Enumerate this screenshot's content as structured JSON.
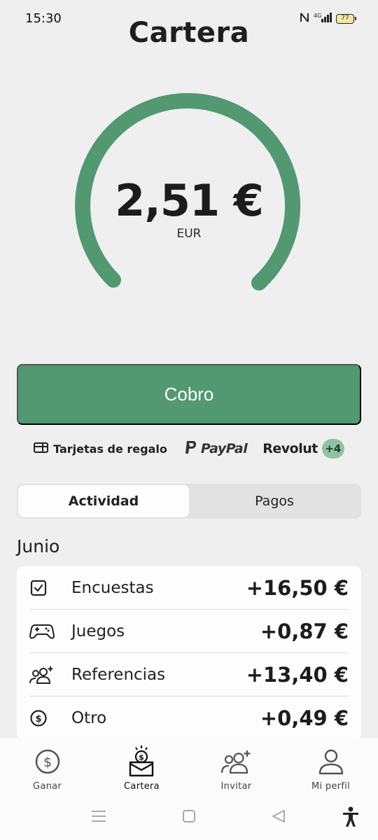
{
  "status_bar": {
    "time": "15:30",
    "network": "4G",
    "battery": "77"
  },
  "page": {
    "title": "Cartera"
  },
  "balance": {
    "amount": "2,51 €",
    "currency": "EUR",
    "gauge_fraction": 0.0
  },
  "actions": {
    "cobro_label": "Cobro"
  },
  "payment_methods": {
    "gift_cards_label": "Tarjetas de regalo",
    "paypal_label": "PayPal",
    "revolut_label": "Revolut",
    "more_label": "+4"
  },
  "tabs": [
    {
      "label": "Actividad",
      "active": true
    },
    {
      "label": "Pagos",
      "active": false
    }
  ],
  "activity": {
    "month": "Junio",
    "items": [
      {
        "label": "Encuestas",
        "value": "+16,50 €",
        "icon": "checkbox-icon"
      },
      {
        "label": "Juegos",
        "value": "+0,87 €",
        "icon": "gamepad-icon"
      },
      {
        "label": "Referencias",
        "value": "+13,40 €",
        "icon": "add-users-icon"
      },
      {
        "label": "Otro",
        "value": "+0,49 €",
        "icon": "dollar-coin-icon"
      }
    ]
  },
  "bottom_nav": [
    {
      "label": "Ganar",
      "icon": "dollar-coin-icon"
    },
    {
      "label": "Cartera",
      "icon": "wallet-icon",
      "active": true
    },
    {
      "label": "Invitar",
      "icon": "invite-users-icon"
    },
    {
      "label": "Mi perfil",
      "icon": "person-icon"
    }
  ],
  "colors": {
    "accent": "#529870",
    "accent_light": "#8fc3a2",
    "background": "#efefef",
    "card": "#fdfdfd"
  }
}
